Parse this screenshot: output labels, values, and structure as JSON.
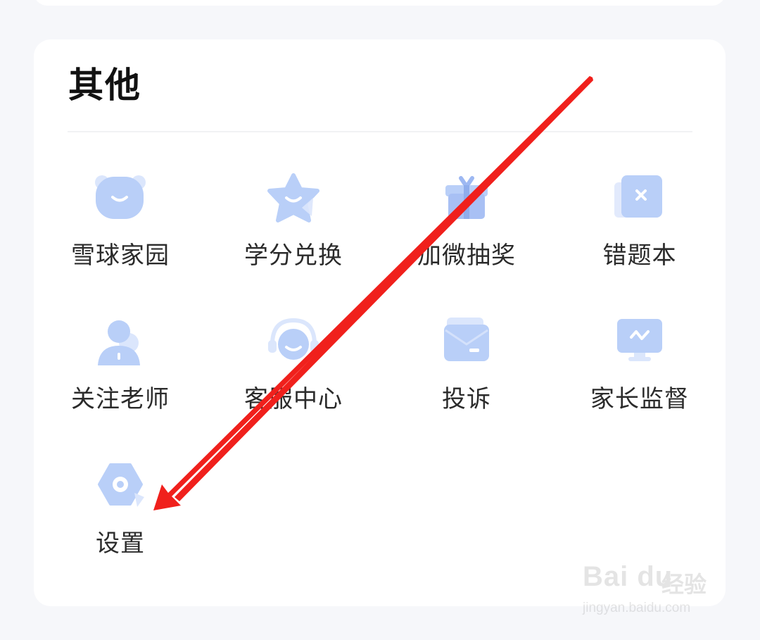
{
  "section": {
    "title": "其他"
  },
  "grid_items": [
    {
      "name": "snowball-home",
      "label": "雪球家园",
      "icon": "bear-icon"
    },
    {
      "name": "credit-exchange",
      "label": "学分兑换",
      "icon": "star-icon"
    },
    {
      "name": "wechat-lottery",
      "label": "加微抽奖",
      "icon": "gift-icon"
    },
    {
      "name": "wrong-question-book",
      "label": "错题本",
      "icon": "error-book-icon"
    },
    {
      "name": "follow-teacher",
      "label": "关注老师",
      "icon": "teacher-icon"
    },
    {
      "name": "customer-service",
      "label": "客服中心",
      "icon": "headset-icon"
    },
    {
      "name": "complaint",
      "label": "投诉",
      "icon": "envelope-icon"
    },
    {
      "name": "parental-supervision",
      "label": "家长监督",
      "icon": "monitor-icon"
    },
    {
      "name": "settings",
      "label": "设置",
      "icon": "gear-icon"
    }
  ],
  "watermark": {
    "brand": "Bai du",
    "product": "经验",
    "url": "jingyan.baidu.com"
  },
  "colors": {
    "icon_blue": "#b9cff8",
    "icon_blue_dark": "#9db8f2",
    "arrow_red": "#f0201c"
  }
}
